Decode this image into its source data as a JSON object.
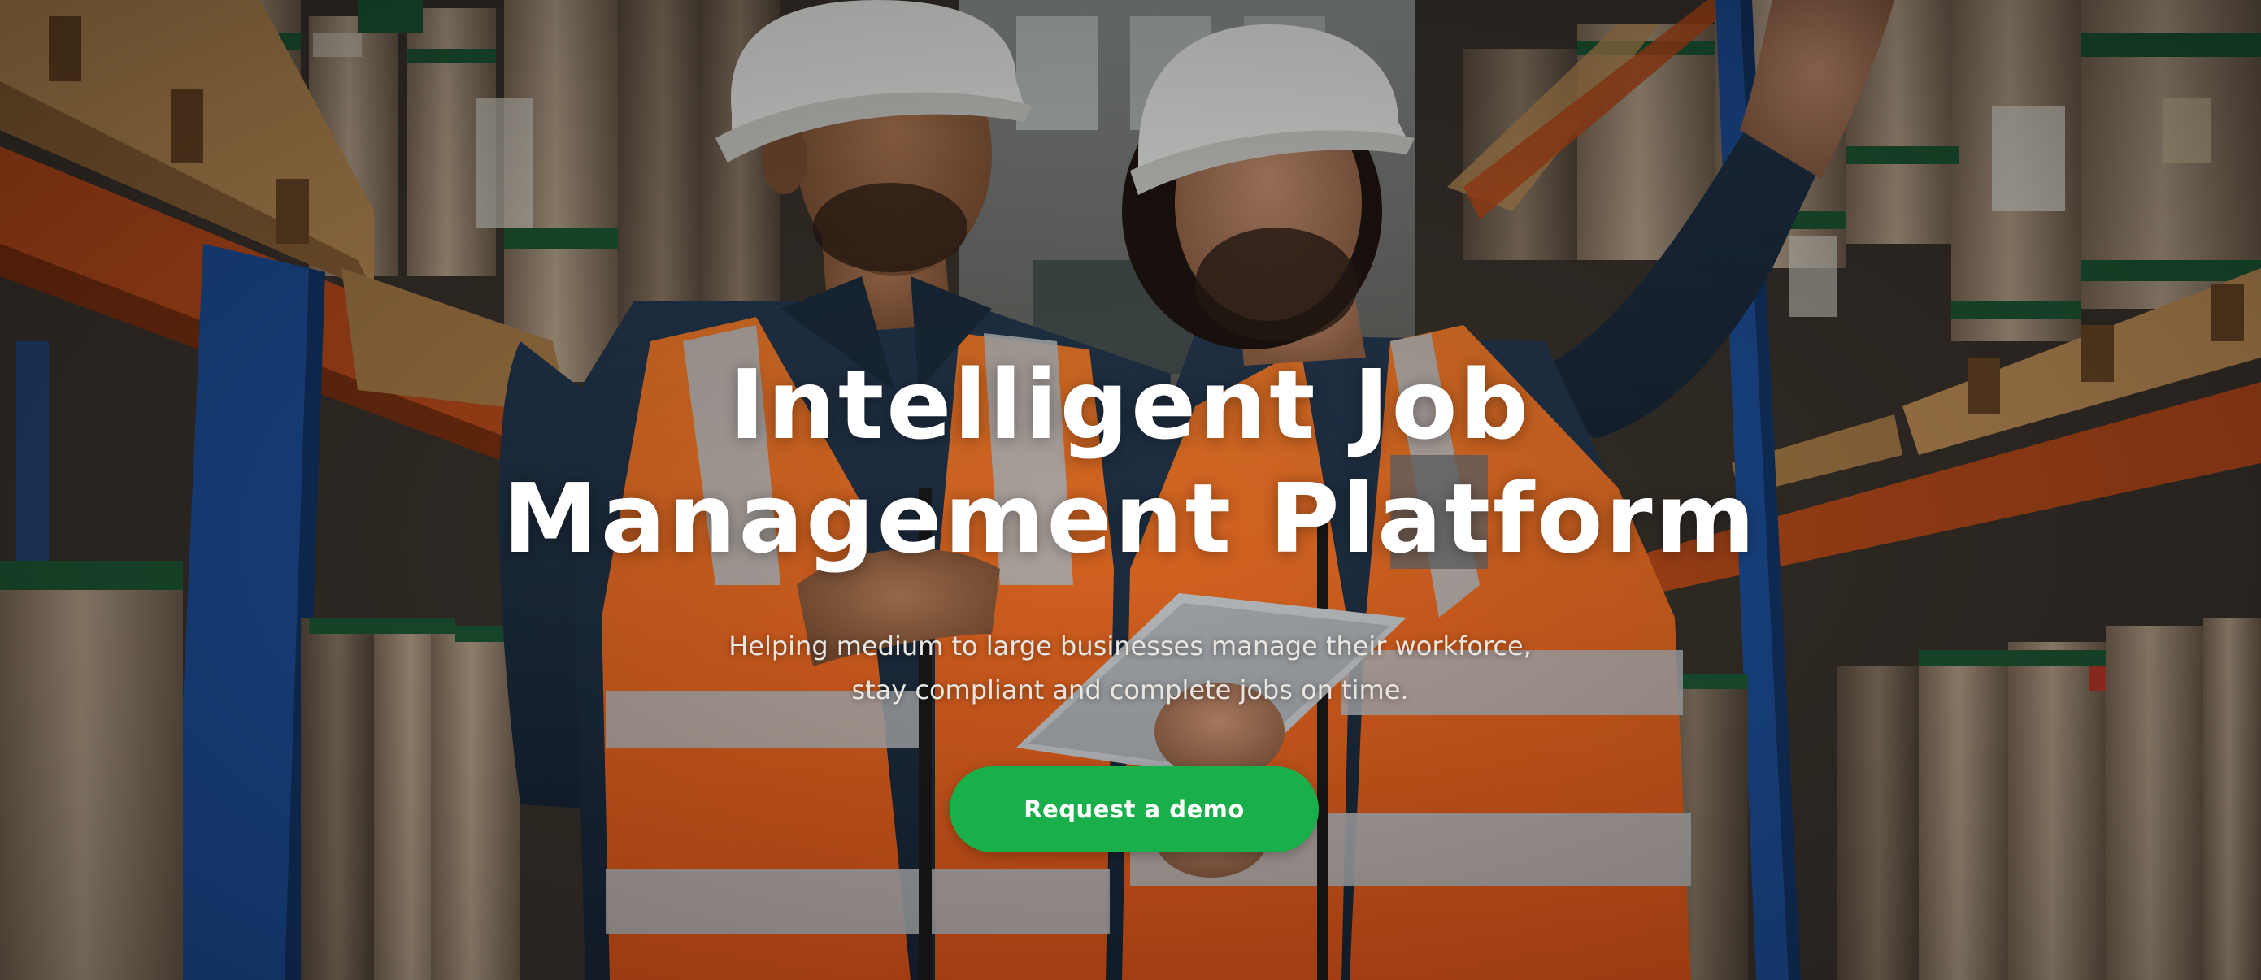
{
  "hero": {
    "title_line1": "Intelligent Job",
    "title_line2": "Management Platform",
    "subtitle_line1": "Helping medium to large businesses manage their workforce,",
    "subtitle_line2": "stay compliant and complete jobs on time.",
    "cta_label": "Request a demo"
  },
  "colors": {
    "cta_background": "#19b04b",
    "title_text": "#ffffff",
    "subtitle_text": "#e9e6e2",
    "vest_orange": "#f26a1b",
    "reflective_stripe": "#b9bcbf",
    "shelf_orange": "#c9531f",
    "shelf_blue": "#1d4f9a"
  }
}
